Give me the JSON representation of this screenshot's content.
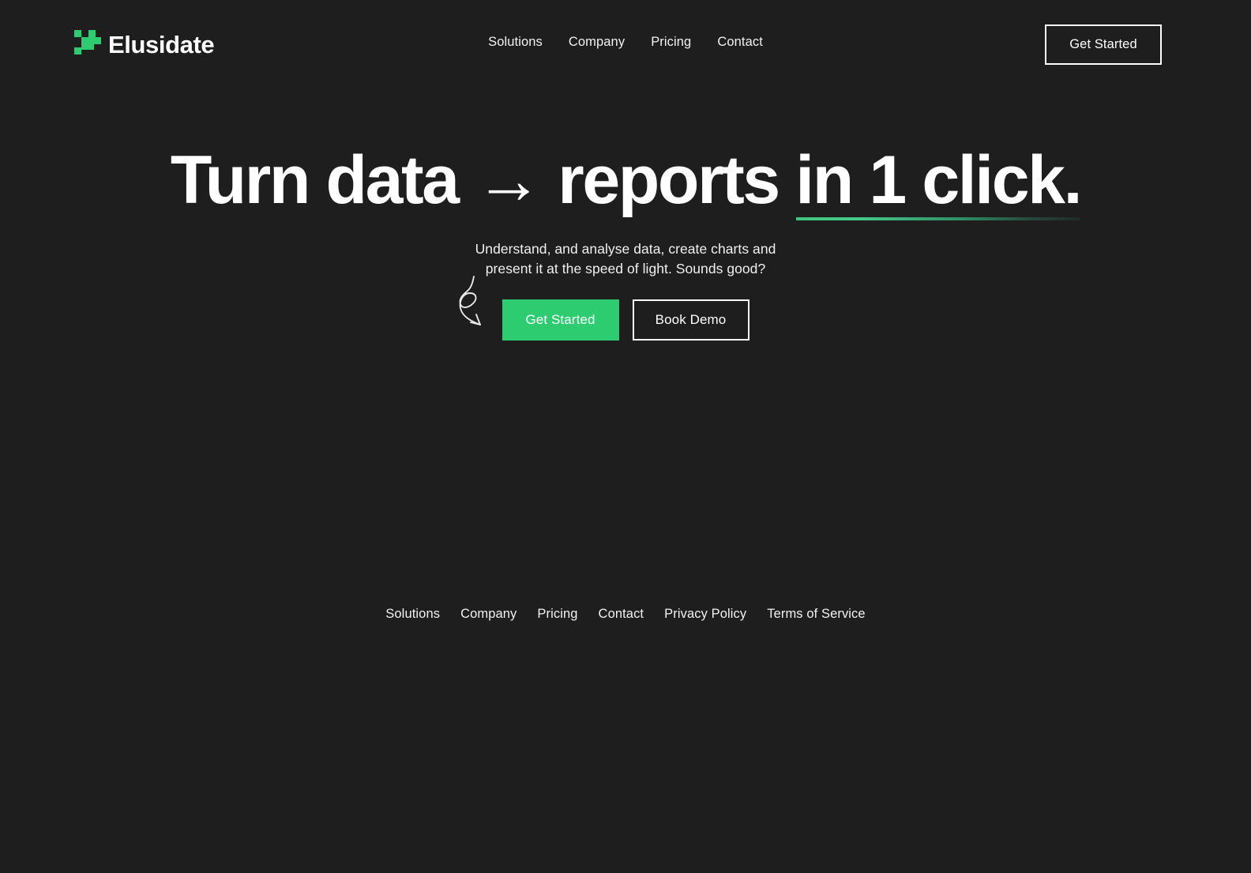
{
  "theme": {
    "background": "#1e1e1e",
    "accent": "#2ecc71",
    "text": "#ffffff",
    "underline_gradient_start": "#3ec77f",
    "underline_gradient_end": "#1f2a27"
  },
  "header": {
    "brand": {
      "name": "Elusidate",
      "logo_icon": "elusidate-blocks-logo-icon"
    },
    "nav": [
      {
        "label": "Solutions"
      },
      {
        "label": "Company"
      },
      {
        "label": "Pricing"
      },
      {
        "label": "Contact"
      }
    ],
    "cta": {
      "label": "Get Started"
    }
  },
  "hero": {
    "title": {
      "plain_prefix": "Turn data ",
      "arrow_glyph": "→",
      "middle": " reports ",
      "underlined": "in 1 click."
    },
    "subtitle_line1": "Understand, and analyse data, create charts and",
    "subtitle_line2": "present it at the speed of light. Sounds good?",
    "primary_cta": {
      "label": "Get Started"
    },
    "secondary_cta": {
      "label": "Book Demo"
    },
    "decoration": {
      "icon": "curly-arrow-doodle-icon"
    }
  },
  "footer": {
    "links": [
      {
        "label": "Solutions"
      },
      {
        "label": "Company"
      },
      {
        "label": "Pricing"
      },
      {
        "label": "Contact"
      },
      {
        "label": "Privacy Policy"
      },
      {
        "label": "Terms of Service"
      }
    ]
  }
}
